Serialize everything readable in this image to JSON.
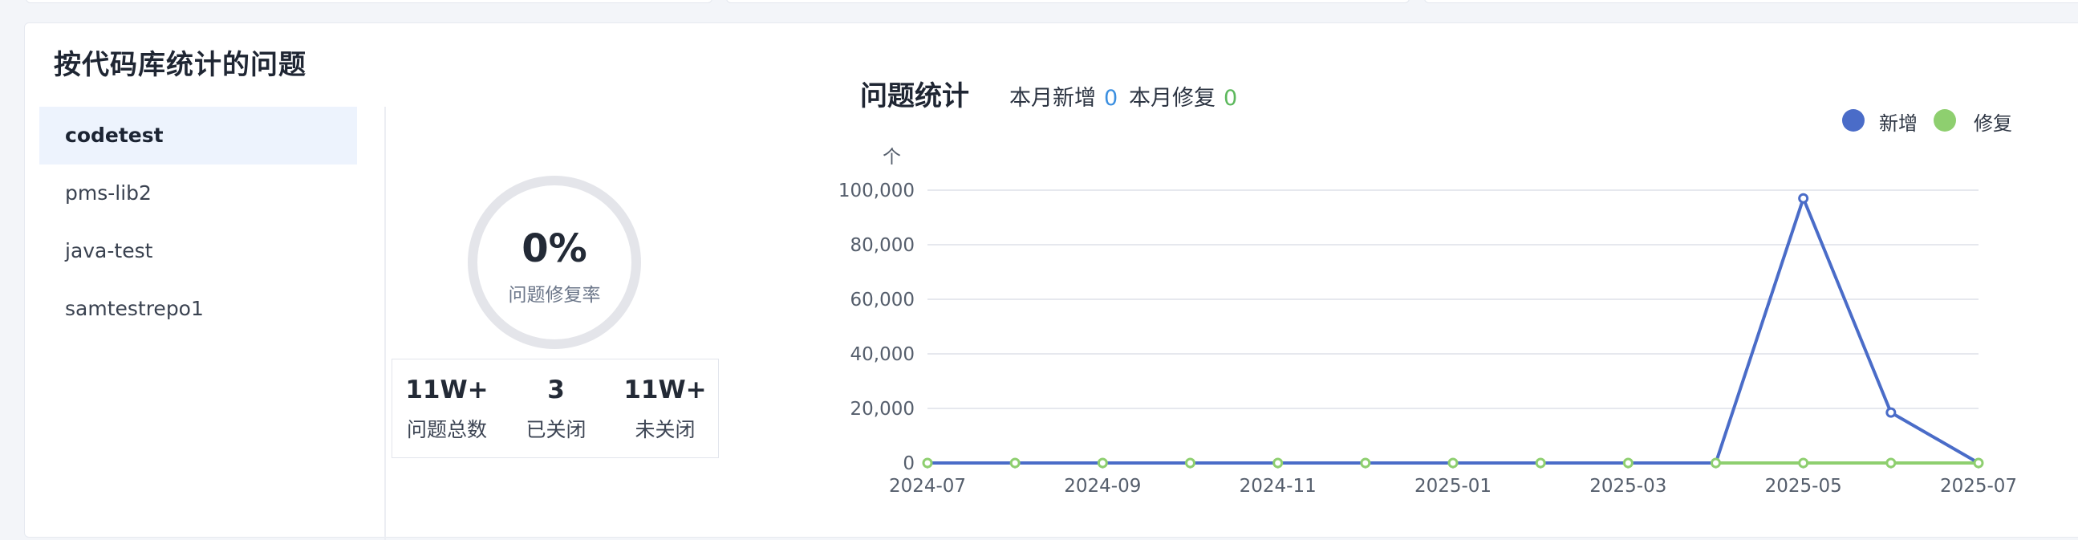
{
  "panel": {
    "title": "按代码库统计的问题"
  },
  "repos": [
    {
      "label": "codetest",
      "active": true
    },
    {
      "label": "pms-lib2",
      "active": false
    },
    {
      "label": "java-test",
      "active": false
    },
    {
      "label": "samtestrepo1",
      "active": false
    }
  ],
  "fix_rate": {
    "value": "0%",
    "label": "问题修复率"
  },
  "stats": [
    {
      "value": "11W+",
      "label": "问题总数"
    },
    {
      "value": "3",
      "label": "已关闭"
    },
    {
      "value": "11W+",
      "label": "未关闭"
    }
  ],
  "chart_header": {
    "title": "问题统计",
    "new_label": "本月新增",
    "new_value": "0",
    "fix_label": "本月修复",
    "fix_value": "0"
  },
  "chart_data": {
    "type": "line",
    "y_unit": "个",
    "x": [
      "2024-07",
      "2024-08",
      "2024-09",
      "2024-10",
      "2024-11",
      "2024-12",
      "2025-01",
      "2025-02",
      "2025-03",
      "2025-04",
      "2025-05",
      "2025-06",
      "2025-07"
    ],
    "x_tick_labels": [
      "2024-07",
      "2024-09",
      "2024-11",
      "2025-01",
      "2025-03",
      "2025-05",
      "2025-07"
    ],
    "y_ticks": [
      "0",
      "20,000",
      "40,000",
      "60,000",
      "80,000",
      "100,000"
    ],
    "ylim": [
      0,
      100000
    ],
    "grid": true,
    "legend_position": "top-right",
    "series": [
      {
        "name": "新增",
        "color": "#4a6cc8",
        "values": [
          0,
          0,
          0,
          0,
          0,
          0,
          0,
          0,
          0,
          0,
          97000,
          18500,
          0
        ]
      },
      {
        "name": "修复",
        "color": "#8ecf6f",
        "values": [
          0,
          0,
          0,
          0,
          0,
          0,
          0,
          0,
          0,
          0,
          0,
          0,
          0
        ]
      }
    ]
  }
}
